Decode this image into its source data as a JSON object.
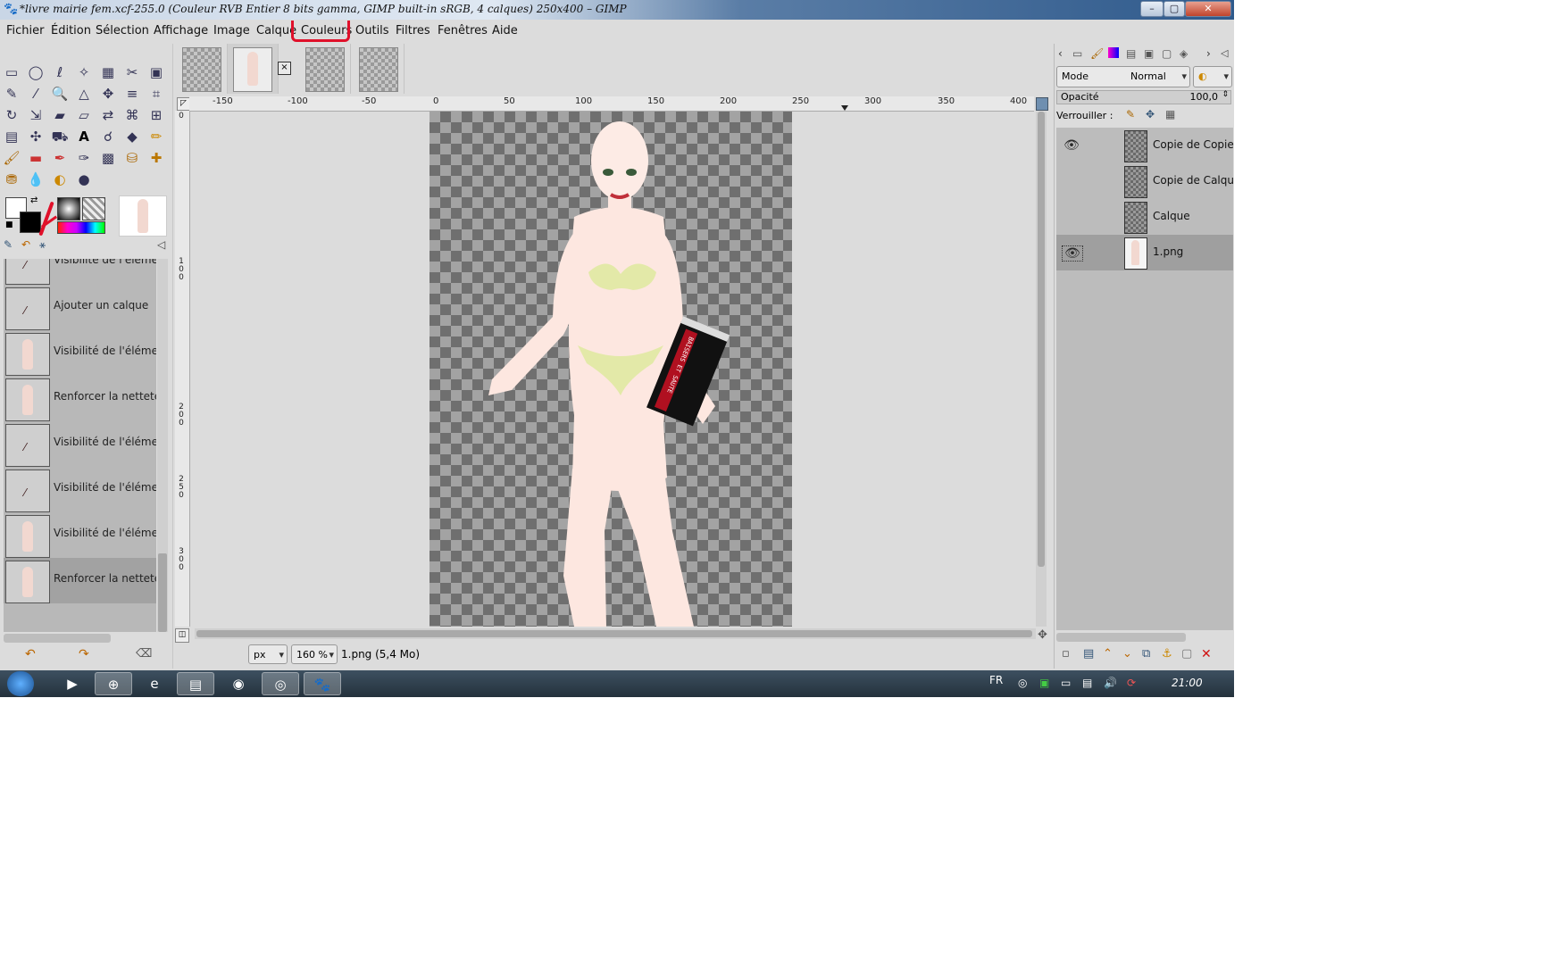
{
  "window": {
    "title": "*livre mairie fem.xcf-255.0 (Couleur RVB Entier 8 bits gamma, GIMP built-in sRGB, 4 calques) 250x400 – GIMP",
    "minimize": "–",
    "maximize": "▢",
    "close": "✕"
  },
  "menu": [
    "Fichier",
    "Édition",
    "Sélection",
    "Affichage",
    "Image",
    "Calque",
    "Couleurs",
    "Outils",
    "Filtres",
    "Fenêtres",
    "Aide"
  ],
  "undo_history": [
    {
      "label": "Visibilité de l'éléme",
      "thumb": "stroke"
    },
    {
      "label": "Ajouter un calque",
      "thumb": "stroke"
    },
    {
      "label": "Visibilité de l'éléme",
      "thumb": "figure"
    },
    {
      "label": "Renforcer la netteté",
      "thumb": "figure"
    },
    {
      "label": "Visibilité de l'éléme",
      "thumb": "stroke"
    },
    {
      "label": "Visibilité de l'éléme",
      "thumb": "stroke"
    },
    {
      "label": "Visibilité de l'éléme",
      "thumb": "figure"
    },
    {
      "label": "Renforcer la netteté",
      "thumb": "figure"
    }
  ],
  "ruler_top": [
    "-150",
    "-100",
    "-50",
    "0",
    "50",
    "100",
    "150",
    "200",
    "250",
    "300",
    "350",
    "400"
  ],
  "ruler_left": [
    "0",
    "1\n0\n0",
    "2\n0\n0",
    "2\n5\n0",
    "3\n0\n0"
  ],
  "book_text": "BAISERS ET SAUTE",
  "status": {
    "unit": "px",
    "zoom": "160 %",
    "info": "1.png (5,4 Mo)"
  },
  "layers_panel": {
    "mode_label": "Mode",
    "mode_value": "Normal",
    "opacity_label": "Opacité",
    "opacity_value": "100,0",
    "lock_label": "Verrouiller :",
    "layers": [
      {
        "name": "Copie de Copie",
        "visible": true,
        "selected": false
      },
      {
        "name": "Copie de Calque",
        "visible": false,
        "selected": false
      },
      {
        "name": "Calque",
        "visible": false,
        "selected": false
      },
      {
        "name": "1.png",
        "visible": true,
        "selected": true
      }
    ]
  },
  "taskbar": {
    "lang": "FR",
    "clock": "21:00"
  },
  "colors": {
    "annotation": "#e0102a",
    "accent": "#3a5f8f"
  }
}
